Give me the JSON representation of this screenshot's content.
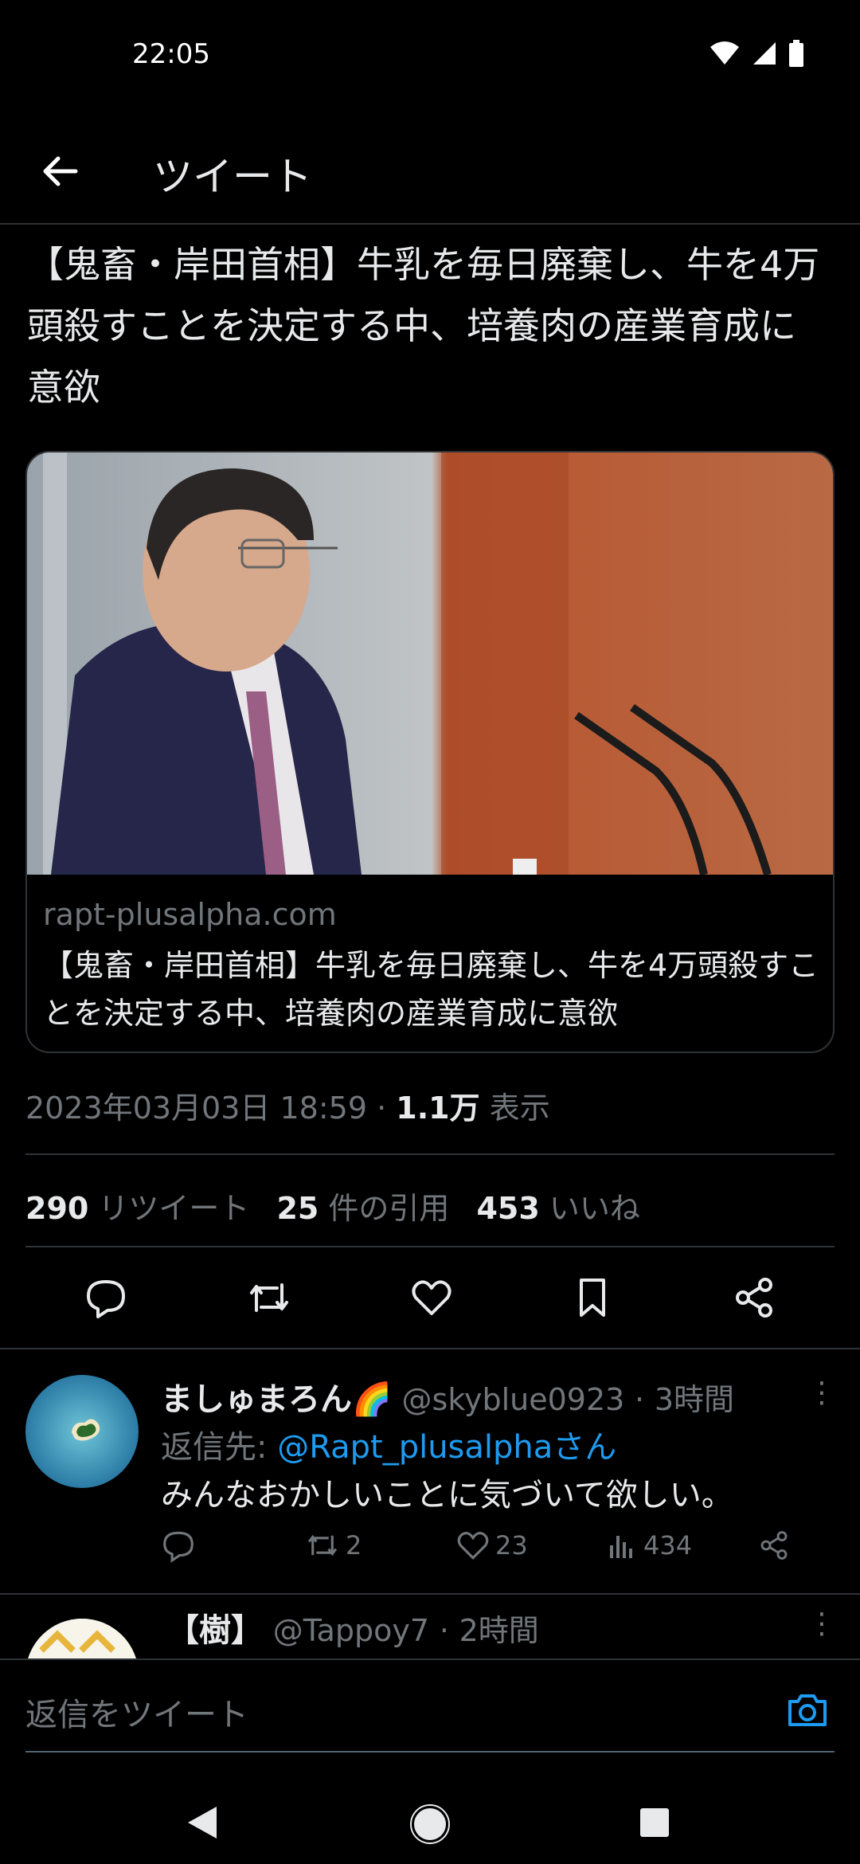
{
  "status_bar": {
    "time": "22:05"
  },
  "header": {
    "title": "ツイート"
  },
  "tweet": {
    "text": "【鬼畜・岸田首相】牛乳を毎日廃棄し、牛を4万頭殺すことを決定する中、培養肉の産業育成に意欲",
    "card": {
      "domain": "rapt-plusalpha.com",
      "title": "【鬼畜・岸田首相】牛乳を毎日廃棄し、牛を4万頭殺すことを決定する中、培養肉の産業育成に意欲"
    },
    "timestamp": "2023年03月03日 18:59",
    "views_count": "1.1万",
    "views_label": "表示",
    "retweets_count": "290",
    "retweets_label": "リツイート",
    "quotes_count": "25",
    "quotes_label": "件の引用",
    "likes_count": "453",
    "likes_label": "いいね"
  },
  "replies": [
    {
      "name": "ましゅまろん🌈",
      "handle": "@skyblue0923",
      "time": "3時間",
      "reply_to_prefix": "返信先: ",
      "reply_to_user": "@Rapt_plusalphaさん",
      "text": "みんなおかしいことに気づいて欲しい。",
      "retweets": "2",
      "likes": "23",
      "views": "434"
    },
    {
      "name": "【樹】",
      "handle": "@Tappoy7",
      "time": "2時間"
    }
  ],
  "reply_bar": {
    "placeholder": "返信をツイート"
  },
  "colors": {
    "background": "#000000",
    "text": "#e7e9ea",
    "muted": "#71767b",
    "link": "#1d9bf0"
  },
  "icons": [
    "back-arrow-icon",
    "reply-icon",
    "retweet-icon",
    "like-icon",
    "bookmark-icon",
    "share-icon",
    "analytics-icon",
    "camera-icon",
    "more-icon",
    "nav-back-icon",
    "nav-home-icon",
    "nav-recents-icon"
  ]
}
